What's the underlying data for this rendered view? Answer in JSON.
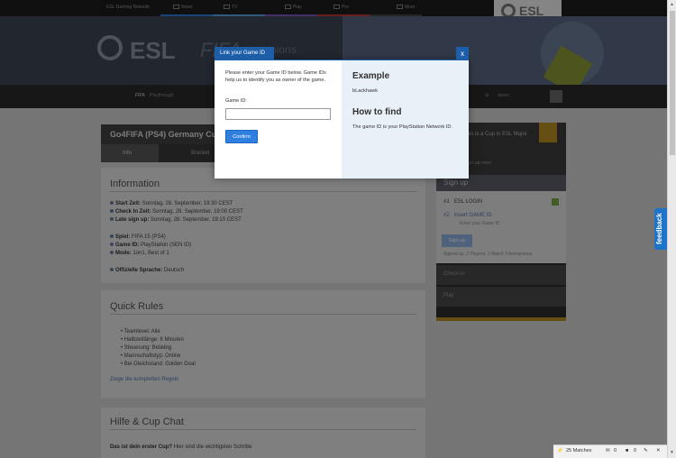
{
  "topnav": {
    "breadcrumb": "ESL Gaming Network",
    "items": [
      {
        "label": "News",
        "icon": "news-icon"
      },
      {
        "label": "TV",
        "icon": "tv-icon"
      },
      {
        "label": "Play",
        "icon": "gamepad-icon"
      },
      {
        "label": "Pro",
        "icon": "trophy-icon"
      },
      {
        "label": "More",
        "icon": "grid-icon"
      }
    ],
    "brand": "ESL"
  },
  "hero": {
    "brand": "ESL",
    "game": "FIFA",
    "suffix": "pions"
  },
  "subnav": {
    "active": "FIFA",
    "label": "Playthrough",
    "user": "qwine",
    "brand_color": "#d4a526"
  },
  "cup": {
    "title": "Go4FIFA (PS4) Germany Cup",
    "tabs": [
      {
        "label": "Info"
      },
      {
        "label": "Bracket"
      }
    ]
  },
  "information": {
    "title": "Information",
    "rows": [
      {
        "label": "Start Zeit:",
        "value": "Sonntag, 28. September, 19:30 CEST"
      },
      {
        "label": "Check In Zeit:",
        "value": "Sonntag, 28. September, 19:00 CEST"
      },
      {
        "label": "Late sign up:",
        "value": "Sonntag, 28. September, 19:10 CEST"
      },
      {
        "label": "Spiel:",
        "value": "FIFA 15 (PS4)"
      },
      {
        "label": "Game ID:",
        "value": "PlayStation (SEN ID)"
      },
      {
        "label": "Mode:",
        "value": "1on1, Best of 1"
      },
      {
        "label": "Offizielle Sprache:",
        "value": "Deutsch"
      }
    ]
  },
  "rules": {
    "title": "Quick Rules",
    "items": [
      "Teamlevel: Alle",
      "Halbzeitlänge: 6 Minuten",
      "Steuerung: Beliebig",
      "Mannschaftstyp: Online",
      "Bei Gleichstand: Golden Goal"
    ],
    "link": "Zeige die kompletten Regeln"
  },
  "help": {
    "title": "Hilfe & Cup Chat",
    "intro_bold": "Das ist dein erster Cup?",
    "intro_rest": " Hier sind die wichtigsten Schritte"
  },
  "sidebar": {
    "promo": "This is a Cup in ESL Major",
    "promo_sub": "Sign up now!",
    "signup_title": "Sign up",
    "steps": [
      {
        "num": "#1",
        "label": "ESL LOGIN"
      },
      {
        "num": "#2",
        "label": "Insert GAME ID",
        "sub": "Enter your Game ID"
      }
    ],
    "join": "Sign up",
    "note": "Signed up: 2 Players, 1 Match 3 Anonymous",
    "groups": [
      "Check-in",
      "Play"
    ]
  },
  "feedback": "feedback",
  "statusbar": {
    "matches": "25 Matches",
    "count_a": "0",
    "count_b": "0"
  },
  "modal": {
    "title": "Link your Game ID",
    "close": "x",
    "intro": "Please enter your Game ID below. Game IDs help us to identify you as owner of the game.",
    "field_label": "Game ID:",
    "field_value": "",
    "confirm": "Confirm",
    "example_title": "Example",
    "example_value": "bLackhawk",
    "howto_title": "How to find",
    "howto_text": "The game ID is your PlayStation Network ID."
  }
}
